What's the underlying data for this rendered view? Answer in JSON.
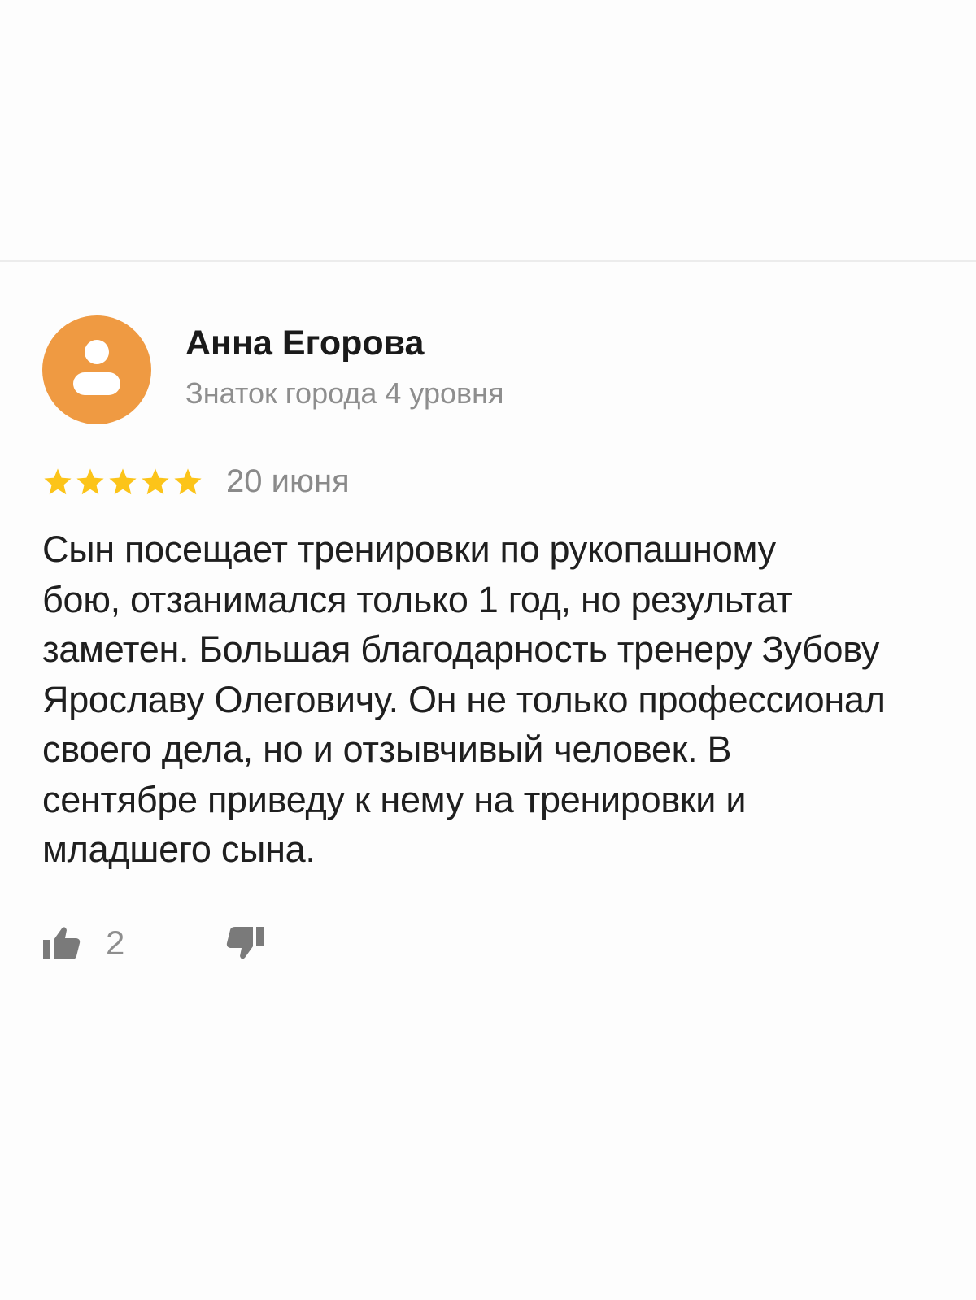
{
  "review": {
    "author_name": "Анна Егорова",
    "author_level": "Знаток города 4 уровня",
    "rating": 5,
    "rating_max": 5,
    "date": "20 июня",
    "text": "Сын посещает тренировки по рукопашному\nбою, отзанимался только 1 год, но результат\nзаметен. Большая благодарность тренеру Зубову\nЯрославу Олеговичу. Он не только профессионал\nсвоего дела, но и отзывчивый человек. В\nсентябре приведу к нему на тренировки и\nмладшего сына.",
    "likes": "2"
  },
  "icons": {
    "avatar": "user-icon",
    "star": "star-icon",
    "like": "thumbs-up-icon",
    "dislike": "thumbs-down-icon"
  },
  "colors": {
    "avatar_bg": "#ef9a42",
    "star": "#fcc419",
    "secondary_text": "#8e8e8e"
  }
}
